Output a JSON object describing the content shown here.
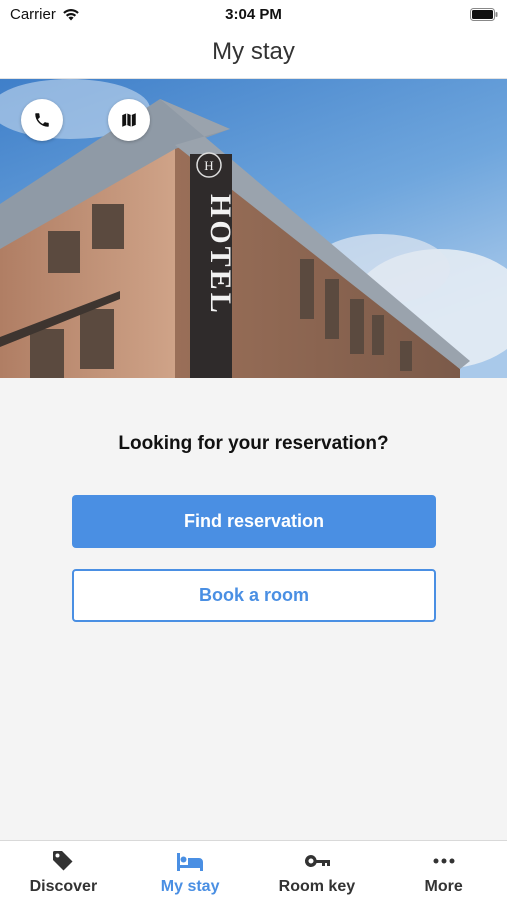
{
  "status_bar": {
    "carrier": "Carrier",
    "time": "3:04 PM"
  },
  "header": {
    "title": "My stay"
  },
  "hero": {
    "sign_text": "HOTEL",
    "logo_letter": "H"
  },
  "main": {
    "prompt": "Looking for your reservation?",
    "find_button": "Find reservation",
    "book_button": "Book a room"
  },
  "tabs": [
    {
      "label": "Discover",
      "icon": "tag-icon"
    },
    {
      "label": "My stay",
      "icon": "bed-icon",
      "active": true
    },
    {
      "label": "Room key",
      "icon": "key-icon"
    },
    {
      "label": "More",
      "icon": "more-dots-icon"
    }
  ],
  "colors": {
    "accent": "#4a8fe3",
    "background": "#f4f4f4"
  }
}
